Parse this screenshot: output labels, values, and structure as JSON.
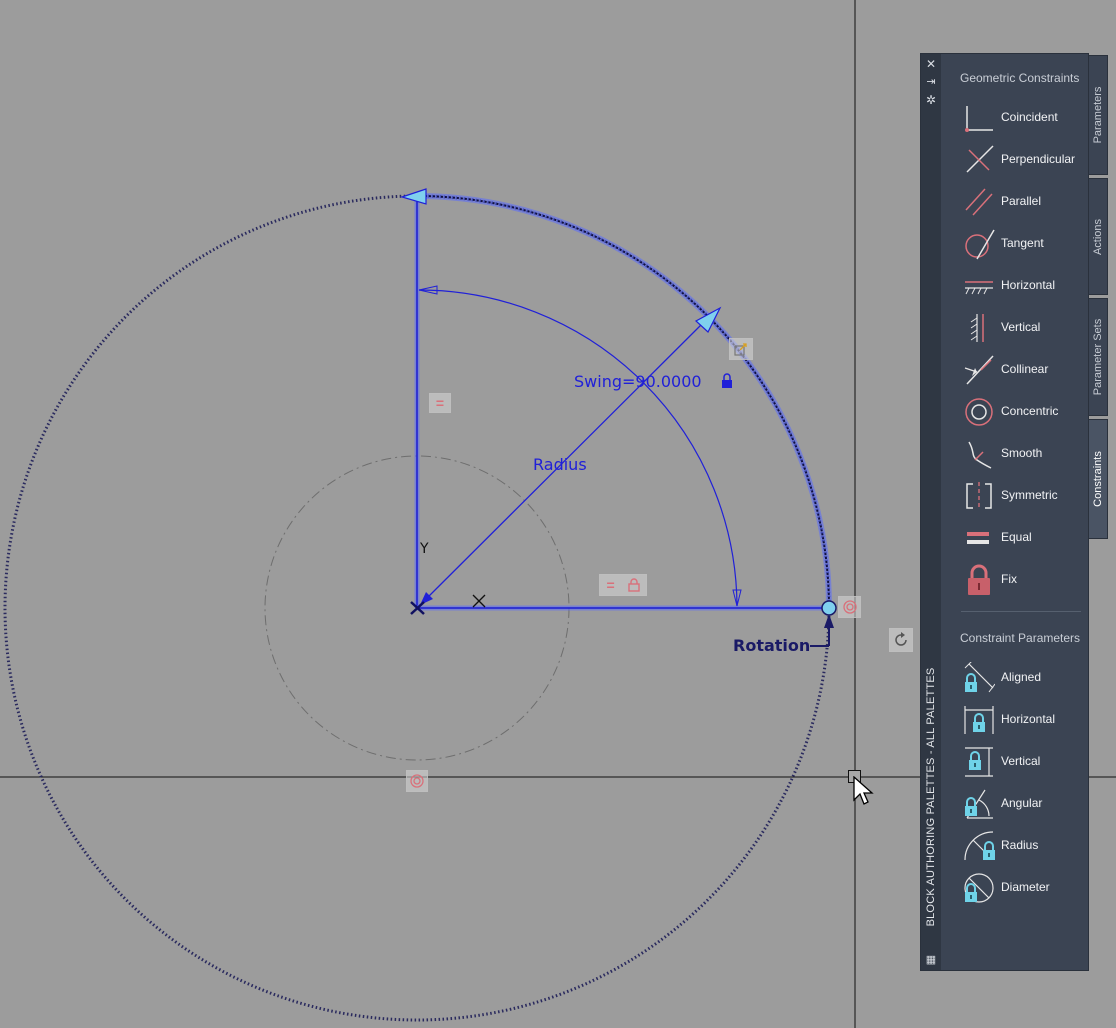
{
  "drawing": {
    "swing_label": "Swing=90.0000",
    "radius_label": "Radius",
    "rotation_label": "Rotation",
    "axis_y": "Y",
    "axis_x": "X",
    "equal_glyph": "="
  },
  "palette": {
    "title": "BLOCK AUTHORING PALETTES - ALL PALETTES",
    "geometric_header": "Geometric Constraints",
    "geometric_items": [
      {
        "label": "Coincident",
        "icon": "coincident-icon"
      },
      {
        "label": "Perpendicular",
        "icon": "perpendicular-icon"
      },
      {
        "label": "Parallel",
        "icon": "parallel-icon"
      },
      {
        "label": "Tangent",
        "icon": "tangent-icon"
      },
      {
        "label": "Horizontal",
        "icon": "horizontal-icon"
      },
      {
        "label": "Vertical",
        "icon": "vertical-icon"
      },
      {
        "label": "Collinear",
        "icon": "collinear-icon"
      },
      {
        "label": "Concentric",
        "icon": "concentric-icon"
      },
      {
        "label": "Smooth",
        "icon": "smooth-icon"
      },
      {
        "label": "Symmetric",
        "icon": "symmetric-icon"
      },
      {
        "label": "Equal",
        "icon": "equal-icon"
      },
      {
        "label": "Fix",
        "icon": "fix-lock-icon"
      }
    ],
    "param_header": "Constraint Parameters",
    "param_items": [
      {
        "label": "Aligned",
        "icon": "aligned-icon"
      },
      {
        "label": "Horizontal",
        "icon": "horizontal-dim-icon"
      },
      {
        "label": "Vertical",
        "icon": "vertical-dim-icon"
      },
      {
        "label": "Angular",
        "icon": "angular-icon"
      },
      {
        "label": "Radius",
        "icon": "radius-icon"
      },
      {
        "label": "Diameter",
        "icon": "diameter-icon"
      }
    ],
    "tabs": [
      {
        "label": "Parameters",
        "active": false
      },
      {
        "label": "Actions",
        "active": false
      },
      {
        "label": "Parameter Sets",
        "active": false
      },
      {
        "label": "Constraints",
        "active": true
      }
    ]
  },
  "colors": {
    "background": "#9c9c9c",
    "dimension_blue": "#2020d8",
    "constraint_red": "#d9707a",
    "lock_cyan": "#6fd3e8",
    "palette_bg": "#3b4453"
  }
}
